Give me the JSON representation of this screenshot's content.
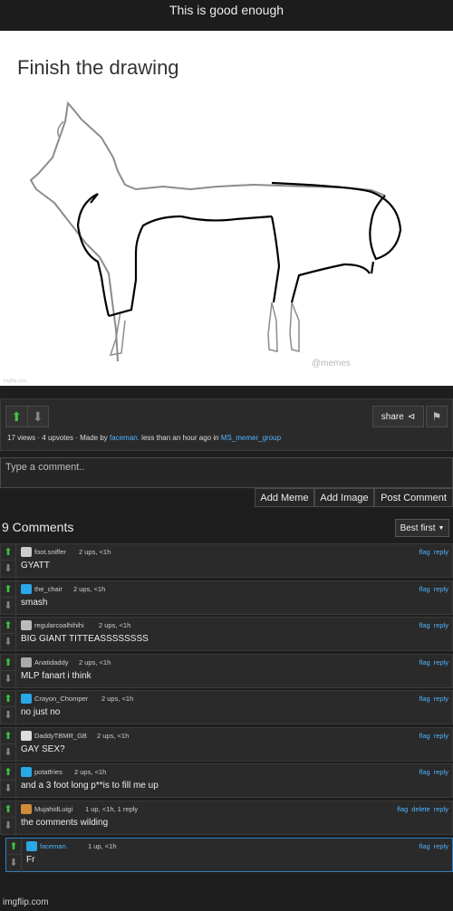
{
  "title": "This is good enough",
  "meme": {
    "heading": "Finish the drawing",
    "watermark": "@memes",
    "imgflip_mark": "imgflip.com"
  },
  "panel": {
    "share_label": "share",
    "views": "17 views",
    "upvotes": "4 upvotes",
    "made_by_prefix": "Made by",
    "author": "faceman.",
    "time": "less than an hour ago in",
    "stream": "MS_memer_group",
    "sep": "·"
  },
  "comment_input": {
    "placeholder": "Type a comment.."
  },
  "buttons": {
    "add_meme": "Add Meme",
    "add_image": "Add Image",
    "post_comment": "Post Comment"
  },
  "comments_header": {
    "count_label": "9 Comments",
    "sort_label": "Best first"
  },
  "colors": {
    "upvote": "#3ec43e",
    "link": "#4fb4ff",
    "background": "#1e1e1e"
  },
  "comments": [
    {
      "user": "foot.sniffer",
      "stats": "2 ups, <1h",
      "text": "GYATT",
      "flag": "flag",
      "reply": "reply",
      "avatar_color": "#cccccc"
    },
    {
      "user": "the_chair",
      "stats": "2 ups, <1h",
      "text": "smash",
      "flag": "flag",
      "reply": "reply",
      "avatar_color": "#2aa7e6"
    },
    {
      "user": "regularcoalhihihi",
      "stats": "2 ups, <1h",
      "text": "BIG GIANT TITTEASSSSSSSS",
      "flag": "flag",
      "reply": "reply",
      "avatar_color": "#bbbbbb"
    },
    {
      "user": "Anatidaddy",
      "stats": "2 ups, <1h",
      "text": "MLP fanart i think",
      "flag": "flag",
      "reply": "reply",
      "avatar_color": "#aaaaaa"
    },
    {
      "user": "Crayon_Chomper",
      "stats": "2 ups, <1h",
      "text": "no just no",
      "flag": "flag",
      "reply": "reply",
      "avatar_color": "#2aa7e6"
    },
    {
      "user": "DaddyTBMR_GB",
      "stats": "2 ups, <1h",
      "text": "GAY SEX?",
      "flag": "flag",
      "reply": "reply",
      "avatar_color": "#dddddd"
    },
    {
      "user": "potatfries",
      "stats": "2 ups, <1h",
      "text": "and a 3 foot long p**is to fill me up",
      "flag": "flag",
      "reply": "reply",
      "avatar_color": "#2aa7e6"
    },
    {
      "user": "MujahidLuigi",
      "stats": "1 up, <1h, 1 reply",
      "text": "the comments wilding",
      "flag": "flag",
      "delete": "delete",
      "reply": "reply",
      "avatar_color": "#d08a3a"
    },
    {
      "user": "faceman.",
      "stats": "1 up, <1h",
      "text": "Fr",
      "flag": "flag",
      "reply": "reply",
      "avatar_color": "#2aa7e6"
    }
  ],
  "footer": "imgflip.com"
}
